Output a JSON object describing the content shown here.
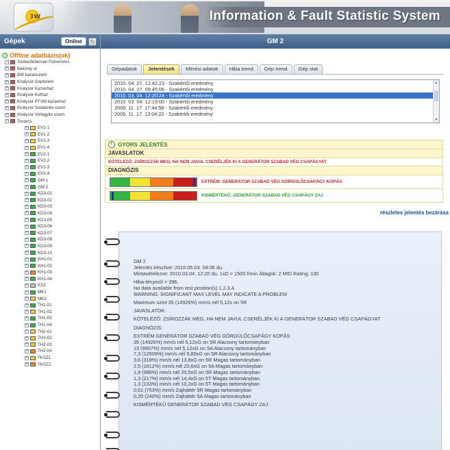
{
  "header": {
    "app_title": "Information & Fault Statistic System",
    "logo_text": "3W"
  },
  "sidebar": {
    "title": "Gépek",
    "online_label": "Online",
    "root_label": "Offline adatbázis(ok)",
    "sites": [
      {
        "label": "Szekesfehervari Futoeromu",
        "expander": "⊟",
        "level": 1
      },
      {
        "label": "Balcony ut",
        "expander": "⊞",
        "level": 1
      },
      {
        "label": "BW kazanuzem",
        "expander": "⊞",
        "level": 1
      },
      {
        "label": "Kiralysor Gepterem",
        "expander": "⊞",
        "level": 1
      },
      {
        "label": "Kiralysor Kazanhaz",
        "expander": "⊞",
        "level": 1
      },
      {
        "label": "Kiralysor Kuthaz",
        "expander": "⊞",
        "level": 1
      },
      {
        "label": "Kiralysor PTVM kazanhaz",
        "expander": "⊞",
        "level": 1
      },
      {
        "label": "Kiralysor Sotalanito uzem",
        "expander": "⊞",
        "level": 1
      },
      {
        "label": "Kiralysor Vizlegyito uzem",
        "expander": "⊞",
        "level": 1
      },
      {
        "label": "Tovaros",
        "expander": "⊟",
        "level": 1
      }
    ],
    "machines": [
      {
        "label": "EV1-1",
        "status": "yellow"
      },
      {
        "label": "EV1-2",
        "status": "yellow"
      },
      {
        "label": "EV1-3",
        "status": "yellow"
      },
      {
        "label": "EV1-4",
        "status": "yellow"
      },
      {
        "label": "EV2-1",
        "status": "green"
      },
      {
        "label": "EV2-2",
        "status": "green"
      },
      {
        "label": "EV2-3",
        "status": "green"
      },
      {
        "label": "EV2-4",
        "status": "green"
      },
      {
        "label": "GM 1",
        "status": "green"
      },
      {
        "label": "GM 2",
        "status": "green"
      },
      {
        "label": "KD3-01",
        "status": "green"
      },
      {
        "label": "KD3-02",
        "status": "green"
      },
      {
        "label": "KD3-03",
        "status": "green"
      },
      {
        "label": "KD3-04",
        "status": "green"
      },
      {
        "label": "KD3-05",
        "status": "green"
      },
      {
        "label": "KD3-06",
        "status": "green"
      },
      {
        "label": "KD3-07",
        "status": "green"
      },
      {
        "label": "KD3-08",
        "status": "green"
      },
      {
        "label": "KD3-09",
        "status": "green"
      },
      {
        "label": "KD3-10",
        "status": "green"
      },
      {
        "label": "KH1-01",
        "status": "green"
      },
      {
        "label": "KH1-02",
        "status": "green"
      },
      {
        "label": "KH1-03",
        "status": "orange"
      },
      {
        "label": "KH1-04",
        "status": "green"
      },
      {
        "label": "KSZ",
        "status": "grey"
      },
      {
        "label": "MK1",
        "status": "green"
      },
      {
        "label": "MK2",
        "status": "yellow"
      },
      {
        "label": "TH1-01",
        "status": "green"
      },
      {
        "label": "TH1-02",
        "status": "yellow"
      },
      {
        "label": "TH1-03",
        "status": "green"
      },
      {
        "label": "TH1-04",
        "status": "green"
      },
      {
        "label": "TH2-01",
        "status": "yellow"
      },
      {
        "label": "TH2-02",
        "status": "yellow"
      },
      {
        "label": "TH2-03",
        "status": "yellow"
      },
      {
        "label": "TH2-04",
        "status": "orange"
      },
      {
        "label": "TKSZ1",
        "status": "yellow"
      },
      {
        "label": "TKSZ2",
        "status": "orange"
      }
    ]
  },
  "main": {
    "title": "GM 2",
    "tabs": [
      {
        "label": "Gépadatok",
        "active": false
      },
      {
        "label": "Jelentések",
        "active": true
      },
      {
        "label": "Mérési adatok",
        "active": false
      },
      {
        "label": "Hiba trend",
        "active": false
      },
      {
        "label": "Gép trend",
        "active": false
      },
      {
        "label": "Gép stat",
        "active": false
      }
    ],
    "reports": [
      {
        "label": "2010. 04. 27. 12:42:23 - Szakértői eredmény",
        "selected": false
      },
      {
        "label": "2010. 04. 27. 09:45:06 - Szakértői eredmény",
        "selected": false
      },
      {
        "label": "2010. 03. 04. 12:20:24 - Szakértői eredmény",
        "selected": true
      },
      {
        "label": "2010. 03. 04. 12:15:00 - Szakértői eredmény",
        "selected": false
      },
      {
        "label": "2009. 11. 17. 17:44:58 - Szakértői eredmény",
        "selected": false
      },
      {
        "label": "2009. 11. 17. 13:04:22 - Szakértői eredmény",
        "selected": false
      }
    ],
    "quick_report": {
      "title": "GYORS JELENTÉS",
      "recommendations_heading": "JAVASLATOK",
      "recommendation": "KÖTELEZŐ: ZSÍROZZÁK MEG, HA NEM JAVUL CSERÉLJÉK KI A GENERÁTOR SZABAD VÉG CSAPÁGYAT",
      "diagnosis_heading": "DIAGNÓZIS",
      "diagnoses": [
        {
          "label": "EXTRÉM: GENERÁTOR SZABAD VÉG GÖRDÜLŐCSAPÁGY KOPÁS",
          "level": 0.98,
          "color": "#d02020"
        },
        {
          "label": "KISMÉRTÉKŰ: GENERÁTOR SZABAD VÉG CSAPÁGY ZAJ",
          "level": 0.03,
          "color": "#2e9b2e"
        }
      ],
      "close_details_label": "részletes jelentés bezárása"
    },
    "detail_lines": [
      "GM 2",
      "Jelentés készítve: 2010.05.03. 04:06 du.",
      "Mintavételezve: 2010.03.04. 12:20 du. 1xD = 1500 f/min Átlagok: 2 MID Rating: 100",
      "",
      "Hiba-tényező = 396,",
      "No data available from test position(s) 1,2,3,4.",
      "WARNING: SIGNIFICANT MAX LEVEL MAY INDICATE A PROBLEM",
      "",
      "Maximum szint 35 (14926%) mm/s nél 5,12x on 5R",
      "",
      "JAVASLATOK:",
      "",
      "KÖTELEZŐ: ZSÍROZZÁK MEG, HA NEM JAVUL CSERÉLJÉK KI A GENERÁTOR SZABAD VÉG CSAPÁGYAT",
      "",
      "DIAGNÓZIS:",
      "",
      "EXTRÉM GENERÁTOR SZABAD VÉG GÖRDÜLŐCSAPÁGY KOPÁS",
      "35 (14926%) mm/s nél 5,12xG on 5R Alacsony tartományban",
      "13 (9907%) mm/s nél 5,12xG on 5A Alacsony tartományban",
      "7,3 (12509%) mm/s nél 5,89xG on 5R Alacsony tartományban",
      "3,6 (318%) mm/s nél 13,8xG on 5R Magas tartományban",
      "2,5 (1612%) mm/s nél 25,6xG on 5A Magas tartományban",
      "1,8 (986%) mm/s nél 20,5xG on 5R Magas tartományban",
      "1,3 (217%) mm/s nél 14,4xG on 5T Magas tartományban",
      "1,3 (133%) mm/s nél 10,2xG on 5T Magas tartományban",
      "0,51 (753%) mm/s Zajháttér 5R Magas tartományban",
      "0,20 (240%) mm/s Zajháttér 5A Magas tartományban",
      "",
      "KISMÉRTÉKŰ GENERÁTOR SZABAD VÉG CSAPÁGY ZAJ"
    ]
  }
}
